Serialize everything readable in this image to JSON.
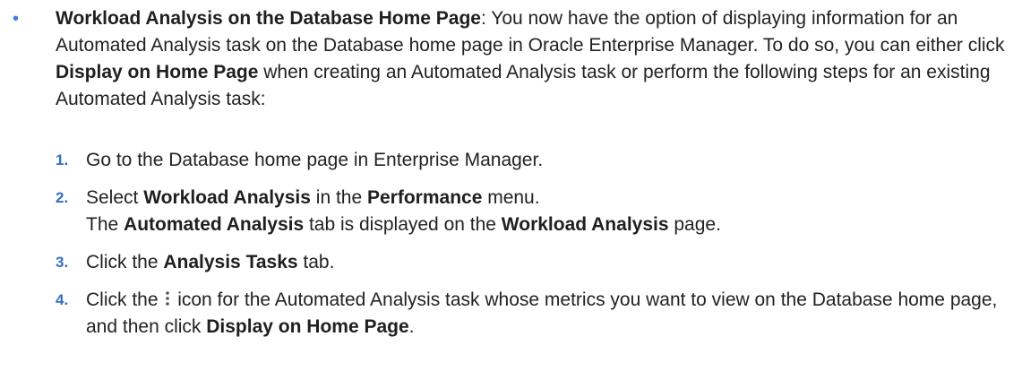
{
  "bullet": {
    "heading": "Workload Analysis on the Database Home Page",
    "sep": ": ",
    "text1": "You now have the option of displaying information for an Automated Analysis task on the Database home page in Oracle Enterprise Manager. To do so, you can either click ",
    "bold1": "Display on Home Page",
    "text2": " when creating an Automated Analysis task or perform the following steps for an existing Automated Analysis task:"
  },
  "steps": [
    {
      "num": "1.",
      "text": "Go to the Database home page in Enterprise Manager."
    },
    {
      "num": "2.",
      "a": "Select ",
      "b1": "Workload Analysis",
      "c": " in the ",
      "b2": "Performance",
      "d": " menu.",
      "e": "The ",
      "b3": "Automated Analysis",
      "f": " tab is displayed on the ",
      "b4": "Workload Analysis",
      "g": " page."
    },
    {
      "num": "3.",
      "a": "Click the ",
      "b1": "Analysis Tasks",
      "c": " tab."
    },
    {
      "num": "4.",
      "a": "Click the ",
      "c": " icon for the Automated Analysis task whose metrics you want to view on the Database home page, and then click ",
      "b1": "Display on Home Page",
      "d": "."
    }
  ],
  "icons": {
    "bullet": "bullet-dot-icon",
    "menu": "kebab-menu-icon"
  },
  "colors": {
    "accent": "#2f6fc4",
    "text": "#222222"
  }
}
